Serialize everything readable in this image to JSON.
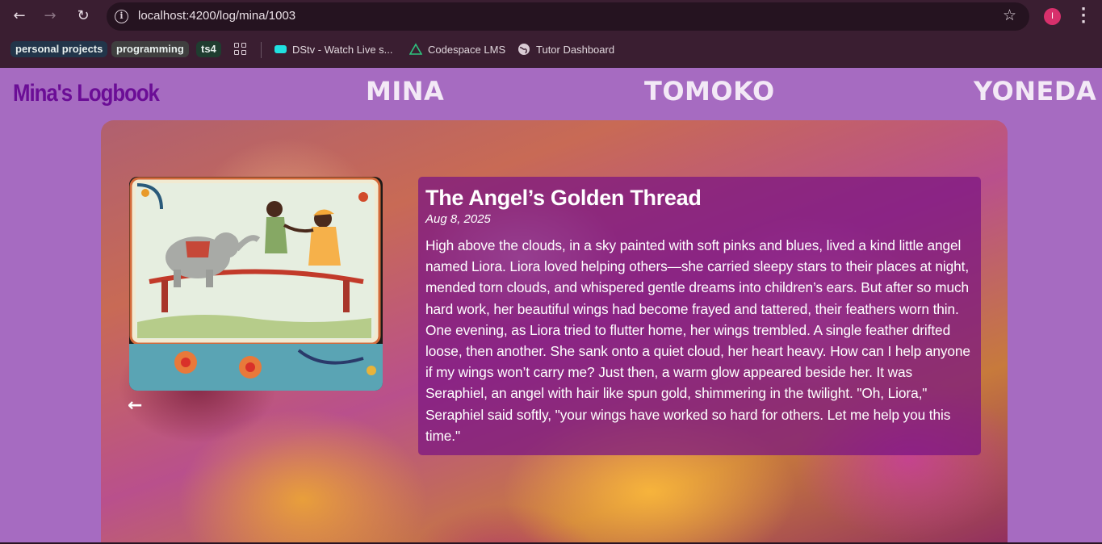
{
  "browser": {
    "url": "localhost:4200/log/mina/1003",
    "profile_initial": "I",
    "bookmarks": [
      {
        "label": "personal projects",
        "kind": "chip"
      },
      {
        "label": "programming",
        "kind": "chip"
      },
      {
        "label": "ts4",
        "kind": "chip"
      },
      {
        "label": "DStv - Watch Live s...",
        "kind": "link"
      },
      {
        "label": "Codespace LMS",
        "kind": "link"
      },
      {
        "label": "Tutor Dashboard",
        "kind": "link"
      }
    ]
  },
  "header": {
    "logo": "Mina's Logbook",
    "names": [
      "MINA",
      "TOMOKO",
      "YONEDA"
    ]
  },
  "story": {
    "title": "The Angel’s Golden Thread",
    "date": "Aug 8, 2025",
    "body": "High above the clouds, in a sky painted with soft pinks and blues, lived a kind little angel named Liora. Liora loved helping others—she carried sleepy stars to their places at night, mended torn clouds, and whispered gentle dreams into children’s ears. But after so much hard work, her beautiful wings had become frayed and tattered, their feathers worn thin. One evening, as Liora tried to flutter home, her wings trembled. A single feather drifted loose, then another. She sank onto a quiet cloud, her heart heavy. How can I help anyone if my wings won’t carry me? Just then, a warm glow appeared beside her. It was Seraphiel, an angel with hair like spun gold, shimmering in the twilight. \"Oh, Liora,\" Seraphiel said softly, \"your wings have worked so hard for others. Let me help you this time.\""
  },
  "colors": {
    "page_bg": "#a66bc1",
    "logo": "#6b0d96",
    "chrome": "#3a1e31",
    "story_panel": "#78148299"
  },
  "icons": {
    "back": "arrow-left-icon",
    "forward": "arrow-right-icon",
    "reload": "reload-icon",
    "info": "info-icon",
    "bookmark": "star-icon",
    "menu": "kebab-menu-icon",
    "apps": "apps-grid-icon"
  }
}
